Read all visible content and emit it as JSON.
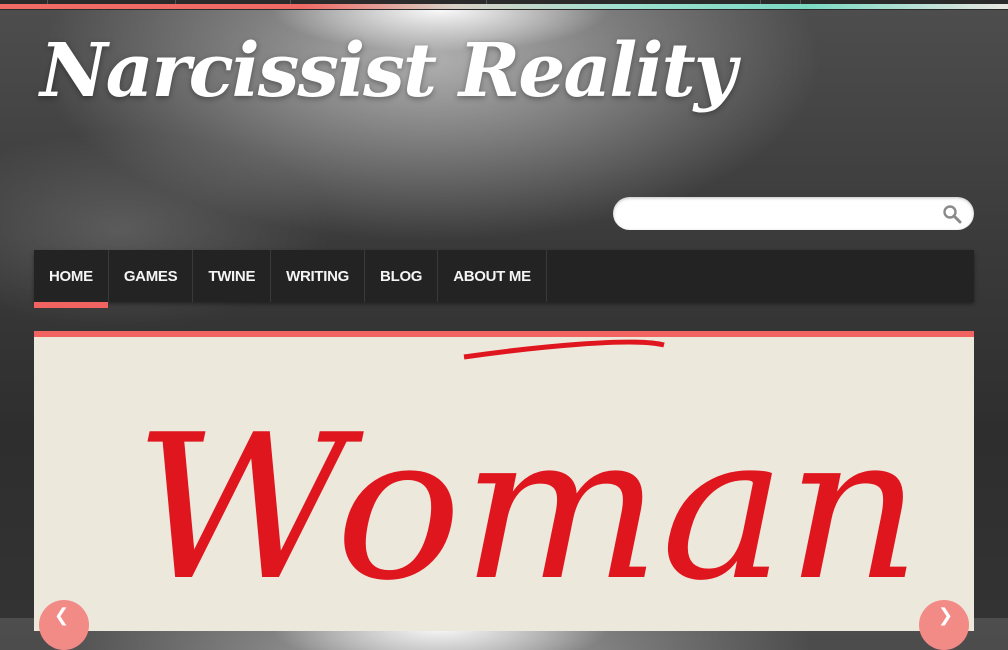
{
  "site": {
    "title": "Narcissist Reality"
  },
  "search": {
    "placeholder": "",
    "value": "",
    "icon": "search-icon"
  },
  "nav": {
    "items": [
      {
        "label": "HOME",
        "active": true
      },
      {
        "label": "GAMES"
      },
      {
        "label": "TWINE"
      },
      {
        "label": "WRITING"
      },
      {
        "label": "BLOG"
      },
      {
        "label": "ABOUT ME"
      }
    ]
  },
  "slider": {
    "slide_text": "Woman",
    "prev_icon": "chevron-left-icon",
    "next_icon": "chevron-right-icon"
  },
  "colors": {
    "accent": "#f06360",
    "nav_bg": "#232323",
    "slide_bg": "#ece8dc",
    "slide_text": "#e0161f"
  }
}
